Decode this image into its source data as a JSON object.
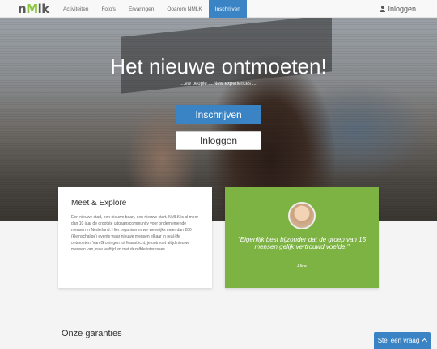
{
  "brand": {
    "logo_prefix": "n",
    "logo_accent": "M",
    "logo_suffix": "lk"
  },
  "nav": {
    "items": [
      {
        "label": "Activiteiten"
      },
      {
        "label": "Foto's"
      },
      {
        "label": "Ervaringen"
      },
      {
        "label": "Ooarom NMLK"
      },
      {
        "label": "Inschrijven",
        "active": true
      }
    ],
    "login_label": "Inloggen"
  },
  "hero": {
    "title": "Het nieuwe ontmoeten!",
    "subtitle": "...ew people ... New experiences ...",
    "primary_button": "Inschrijven",
    "secondary_button": "Inloggen"
  },
  "meet_card": {
    "title": "Meet & Explore",
    "body": "Een nieuwe stad, een nieuwe baan, een nieuwe start. NMLK is al meer dan 10 jaar de grootste uitgaanscommunity voor ondernemende mensen in Nederland. Hier organiseren we wekelijks meer dan 200 (kleinschalige) events waar nieuwe mensen elkaar in real-life ontmoeten. Van Groningen tot Maastricht, je ontmoet altijd nieuwe mensen van jouw leeftijd en met dezelfde interesses."
  },
  "quote_card": {
    "quote": "\"Eigenlijk best bijzonder dat de groep van 15 mensen gelijk vertrouwd voelde.\"",
    "author": "Alice"
  },
  "section": {
    "title": "Onze garanties"
  },
  "chat": {
    "label": "Stel een vraag"
  },
  "colors": {
    "accent_blue": "#3a84c6",
    "accent_green": "#7db343"
  }
}
